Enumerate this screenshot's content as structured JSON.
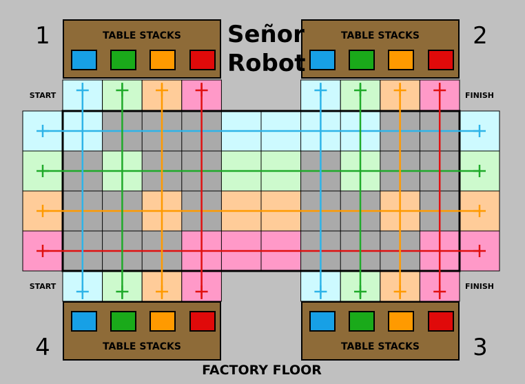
{
  "title": {
    "line1": "Señor",
    "line2": "Robot"
  },
  "footer_label": "FACTORY FLOOR",
  "corner_labels": {
    "start": "START",
    "finish": "FINISH"
  },
  "players": [
    {
      "number": "1",
      "stack_label": "TABLE STACKS"
    },
    {
      "number": "2",
      "stack_label": "TABLE STACKS"
    },
    {
      "number": "3",
      "stack_label": "TABLE STACKS"
    },
    {
      "number": "4",
      "stack_label": "TABLE STACKS"
    }
  ],
  "colors": {
    "background": "#c0c0c0",
    "panel": "#8e6b38",
    "floor_gray": "#aaaaaa",
    "lanes": [
      {
        "name": "blue",
        "line": "#2eb4e8",
        "fill": "#cdfaff",
        "chip": "#17a0e6"
      },
      {
        "name": "green",
        "line": "#1faa2a",
        "fill": "#cdfacd",
        "chip": "#1aaa1a"
      },
      {
        "name": "orange",
        "line": "#ff9a00",
        "fill": "#ffcc99",
        "chip": "#ff9a00"
      },
      {
        "name": "red",
        "line": "#e01010",
        "fill": "#ff99c8",
        "chip": "#e00a0a"
      }
    ]
  }
}
